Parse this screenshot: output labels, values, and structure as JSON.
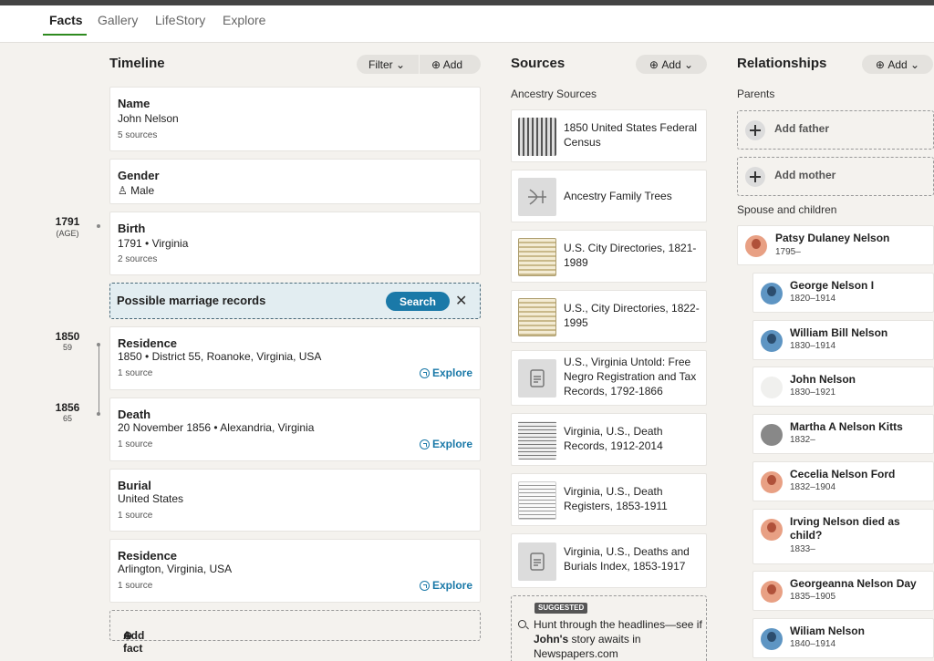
{
  "nav": {
    "tabs": [
      "Facts",
      "Gallery",
      "LifeStory",
      "Explore"
    ]
  },
  "timeline": {
    "heading": "Timeline",
    "filter_label": "Filter",
    "add_label": "Add",
    "facts": [
      {
        "title": "Name",
        "detail": "John Nelson",
        "sources": "5 sources"
      },
      {
        "title": "Gender",
        "detail": "Male"
      },
      {
        "title": "Birth",
        "detail": "1791 • Virginia",
        "sources": "2 sources",
        "year": "1791",
        "age": "(AGE)"
      },
      {
        "title": "Residence",
        "detail": "1850 • District 55, Roanoke, Virginia, USA",
        "sources": "1 source",
        "year": "1850",
        "age": "59",
        "explore": "Explore"
      },
      {
        "title": "Death",
        "detail": "20 November 1856 • Alexandria, Virginia",
        "sources": "1 source",
        "year": "1856",
        "age": "65",
        "explore": "Explore"
      },
      {
        "title": "Burial",
        "detail": "United States",
        "sources": "1 source"
      },
      {
        "title": "Residence",
        "detail": "Arlington, Virginia, USA",
        "sources": "1 source",
        "explore": "Explore"
      }
    ],
    "marriage_prompt": "Possible marriage records",
    "search_label": "Search",
    "add_fact": "Add fact"
  },
  "sources": {
    "heading": "Sources",
    "add_label": "Add",
    "subheading": "Ancestry Sources",
    "items": [
      {
        "label": "1850 United States Federal Census",
        "thumb": "census"
      },
      {
        "label": "Ancestry Family Trees",
        "thumb": "tree"
      },
      {
        "label": "U.S. City Directories, 1821-1989",
        "thumb": "dir"
      },
      {
        "label": "U.S., City Directories, 1822-1995",
        "thumb": "dir"
      },
      {
        "label": "U.S., Virginia Untold: Free Negro Registration and Tax Records, 1792-1866",
        "thumb": "doc"
      },
      {
        "label": "Virginia, U.S., Death Records, 1912-2014",
        "thumb": "reg"
      },
      {
        "label": "Virginia, U.S., Death Registers, 1853-1911",
        "thumb": "reg2"
      },
      {
        "label": "Virginia, U.S., Deaths and Burials Index, 1853-1917",
        "thumb": "doc"
      }
    ],
    "suggested": {
      "badge": "SUGGESTED",
      "pre": "Hunt through the headlines—see if ",
      "name": "John's",
      "post": " story awaits in Newspapers.com"
    }
  },
  "relationships": {
    "heading": "Relationships",
    "add_label": "Add",
    "parents_label": "Parents",
    "add_father": "Add father",
    "add_mother": "Add mother",
    "spouse_label": "Spouse and children",
    "spouse": {
      "name": "Patsy Dulaney Nelson",
      "years": "1795–",
      "avatar": "female"
    },
    "children": [
      {
        "name": "George Nelson I",
        "years": "1820–1914",
        "avatar": "male"
      },
      {
        "name": "William Bill Nelson",
        "years": "1830–1914",
        "avatar": "male"
      },
      {
        "name": "John Nelson",
        "years": "1830–1921",
        "avatar": "none"
      },
      {
        "name": "Martha A Nelson Kitts",
        "years": "1832–",
        "avatar": "photo"
      },
      {
        "name": "Cecelia Nelson Ford",
        "years": "1832–1904",
        "avatar": "female"
      },
      {
        "name": "Irving Nelson died as child?",
        "years": "1833–",
        "avatar": "female"
      },
      {
        "name": "Georgeanna Nelson Day",
        "years": "1835–1905",
        "avatar": "female"
      },
      {
        "name": "Wiliam Nelson",
        "years": "1840–1914",
        "avatar": "male"
      }
    ]
  },
  "colors": {
    "accent_blue": "#1a79a8",
    "tab_underline": "#2e8a1f",
    "background": "#f4f2ee"
  }
}
